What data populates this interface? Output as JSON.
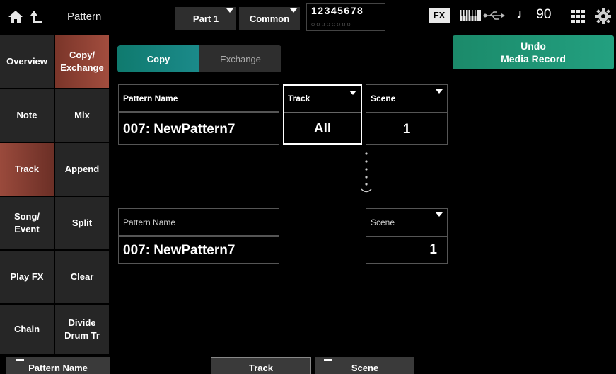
{
  "header": {
    "home_icon": "home-icon",
    "back_icon": "back-arrow-icon",
    "title": "Pattern",
    "part_label": "Part 1",
    "common_label": "Common",
    "track_numbers": "12345678",
    "fx_label": "FX",
    "tempo": "90"
  },
  "tabs_left": [
    {
      "label1": "Overview",
      "label2": ""
    },
    {
      "label1": "Note",
      "label2": ""
    },
    {
      "label1": "Track",
      "label2": ""
    },
    {
      "label1": "Song/",
      "label2": "Event"
    },
    {
      "label1": "Play FX",
      "label2": ""
    },
    {
      "label1": "Chain",
      "label2": ""
    }
  ],
  "tabs_right": [
    {
      "label1": "Copy/",
      "label2": "Exchange"
    },
    {
      "label1": "Mix",
      "label2": ""
    },
    {
      "label1": "Append",
      "label2": ""
    },
    {
      "label1": "Split",
      "label2": ""
    },
    {
      "label1": "Clear",
      "label2": ""
    },
    {
      "label1": "Divide",
      "label2": "Drum Tr"
    }
  ],
  "mode_toggle": {
    "copy": "Copy",
    "exchange": "Exchange"
  },
  "undo": {
    "line1": "Undo",
    "line2": "Media Record"
  },
  "source": {
    "pattern_name_label": "Pattern Name",
    "pattern_name_value": "007: NewPattern7",
    "track_label": "Track",
    "track_value": "All",
    "scene_label": "Scene",
    "scene_value": "1"
  },
  "dest": {
    "pattern_name_label": "Pattern Name",
    "pattern_name_value": "007: NewPattern7",
    "scene_label": "Scene",
    "scene_value": "1"
  },
  "bottom": {
    "pattern_name": "Pattern Name",
    "track": "Track",
    "scene": "Scene"
  }
}
